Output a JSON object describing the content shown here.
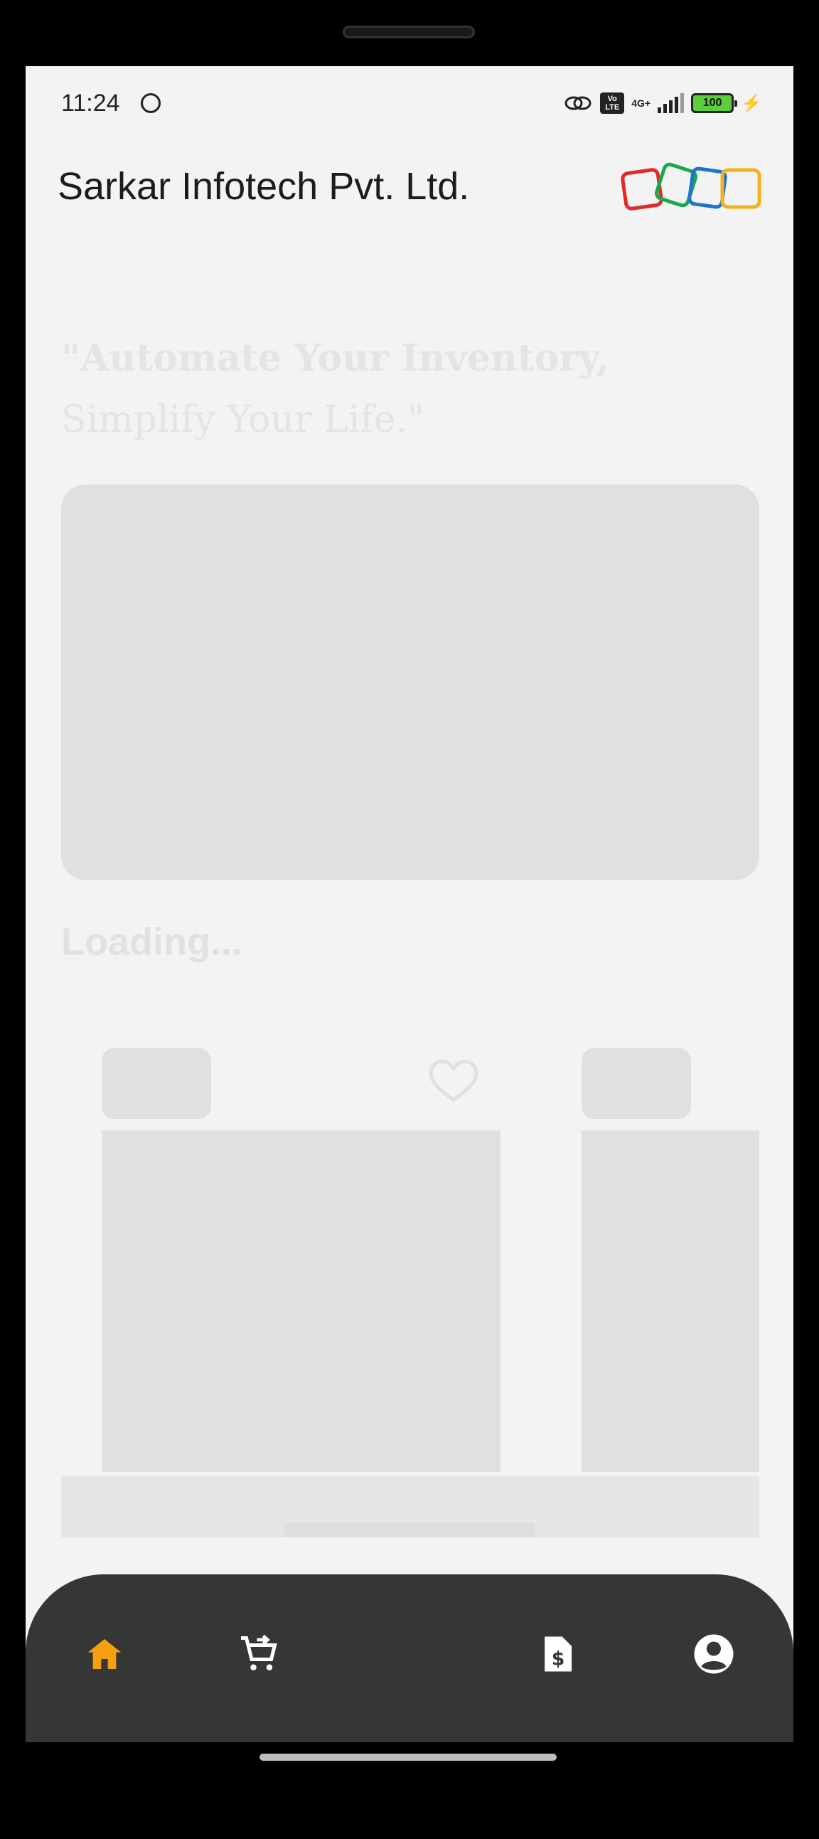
{
  "status_bar": {
    "time": "11:24",
    "network": "4G+",
    "volte": "Vo LTE",
    "battery": "100"
  },
  "header": {
    "company_name": "Sarkar Infotech Pvt. Ltd.",
    "logo_colors": [
      "#e22a2a",
      "#1aa84a",
      "#1a76c8",
      "#f5b21e"
    ]
  },
  "tagline": {
    "line1": "\"Automate Your Inventory,",
    "line2": " Simplify Your Life.\""
  },
  "section": {
    "loading_text": "Loading..."
  },
  "bottom_nav": {
    "items": [
      {
        "icon": "home-icon",
        "active": true
      },
      {
        "icon": "cart-add-icon",
        "active": false
      },
      {
        "icon": "invoice-dollar-icon",
        "active": false
      },
      {
        "icon": "account-icon",
        "active": false
      }
    ],
    "active_color": "#f5a00f",
    "icon_color": "#ffffff"
  }
}
